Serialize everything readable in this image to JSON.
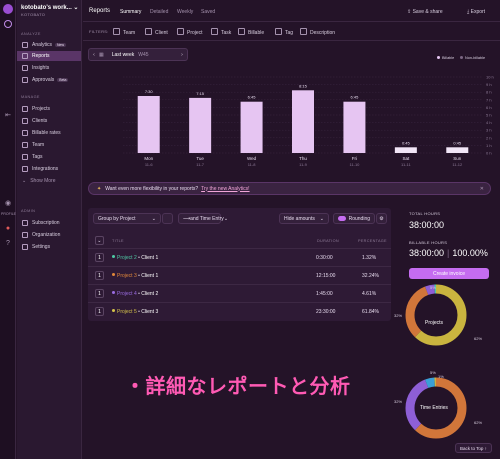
{
  "sidebar": {
    "workspace_name": "kotobato's work...",
    "workspace_sub": "KOTOBATO",
    "analyze_label": "ANALYZE",
    "manage_label": "MANAGE",
    "admin_label": "ADMIN",
    "analytics": {
      "label": "Analytics",
      "badge": "New"
    },
    "reports": {
      "label": "Reports"
    },
    "insights": {
      "label": "Insights"
    },
    "approvals": {
      "label": "Approvals",
      "badge": "Beta"
    },
    "projects": {
      "label": "Projects"
    },
    "clients": {
      "label": "Clients"
    },
    "billable_rates": {
      "label": "Billable rates"
    },
    "team": {
      "label": "Team"
    },
    "tags": {
      "label": "Tags"
    },
    "integrations": {
      "label": "Integrations"
    },
    "show_more": {
      "label": "Show More"
    },
    "subscription": {
      "label": "Subscription"
    },
    "organization": {
      "label": "Organization"
    },
    "settings": {
      "label": "Settings"
    }
  },
  "rail": {
    "profile_label": "PROFILE"
  },
  "header": {
    "title": "Reports",
    "tabs": [
      "Summary",
      "Detailed",
      "Weekly",
      "Saved"
    ],
    "save_share": "Save & share",
    "export": "Export"
  },
  "filters": {
    "label": "FILTERS:",
    "items": [
      "Team",
      "Client",
      "Project",
      "Task",
      "Billable",
      "Tag",
      "Description"
    ]
  },
  "date": {
    "label": "Last week",
    "week": "W45"
  },
  "legend": {
    "billable": "Billable",
    "non_billable": "Non-billable"
  },
  "colors": {
    "accent": "#c56cf0",
    "bar": "#e6c5f2",
    "bar_small": "#f2e6f7",
    "headline": "#ff5ab4"
  },
  "chart_data": {
    "type": "bar",
    "categories": [
      "Mon",
      "Tue",
      "Wed",
      "Thu",
      "Fri",
      "Sat",
      "Sun"
    ],
    "dates": [
      "11-6",
      "11-7",
      "11-8",
      "11-9",
      "11-10",
      "11-11",
      "11-12"
    ],
    "value_labels": [
      "7:30",
      "7:15",
      "6:45",
      "8:15",
      "6:45",
      "0:45",
      "0:45"
    ],
    "values": [
      7.5,
      7.25,
      6.75,
      8.25,
      6.75,
      0.75,
      0.75
    ],
    "ylabel_ticks": [
      "10 h",
      "9 h",
      "8 h",
      "7 h",
      "6 h",
      "5 h",
      "4 h",
      "3 h",
      "2 h",
      "1 h",
      "0 h"
    ],
    "ylim": [
      0,
      10
    ],
    "grid": true
  },
  "promo": {
    "text": "Want even more flexibility in your reports?",
    "link": "Try the new Analytics!"
  },
  "table": {
    "group_by": "Group by Project",
    "and_by": "and Time Entry",
    "hide_amounts": "Hide amounts",
    "rounding": "Rounding",
    "col_title": "TITLE",
    "col_duration": "DURATION",
    "col_percentage": "PERCENTAGE",
    "rows": [
      {
        "num": "1",
        "project": "Project 2",
        "client": "Client 1",
        "duration": "0:30:00",
        "pct": "1.32%",
        "color": "#4ec9a4"
      },
      {
        "num": "1",
        "project": "Project 3",
        "client": "Client 1",
        "duration": "12:15:00",
        "pct": "32.24%",
        "color": "#e0873a"
      },
      {
        "num": "1",
        "project": "Project 4",
        "client": "Client 2",
        "duration": "1:45:00",
        "pct": "4.61%",
        "color": "#9a6ce0"
      },
      {
        "num": "1",
        "project": "Project 5",
        "client": "Client 3",
        "duration": "23:30:00",
        "pct": "61.84%",
        "color": "#d4c24a"
      }
    ]
  },
  "summary": {
    "total_label": "TOTAL HOURS",
    "total_value": "38:00:00",
    "billable_label": "BILLABLE HOURS",
    "billable_value": "38:00:00",
    "billable_pct": "100.00%",
    "create_invoice": "Create invoice"
  },
  "donuts": [
    {
      "label": "Projects",
      "slices": [
        {
          "pct": 62,
          "color": "#c9b43f"
        },
        {
          "pct": 32,
          "color": "#d1763a"
        },
        {
          "pct": 5,
          "color": "#8e5fd6"
        },
        {
          "pct": 1,
          "color": "#4ec9a4"
        }
      ],
      "labels": [
        "62%",
        "32%",
        "5%"
      ]
    },
    {
      "label": "Time Entries",
      "slices": [
        {
          "pct": 62,
          "color": "#d1763a"
        },
        {
          "pct": 32,
          "color": "#8e5fd6"
        },
        {
          "pct": 5,
          "color": "#3a9fd6"
        },
        {
          "pct": 1,
          "color": "#c9b43f"
        }
      ],
      "labels": [
        "62%",
        "32%",
        "5%",
        "1%"
      ]
    }
  ],
  "headline": "・詳細なレポートと分析",
  "back_to_top": "Back to Top ↑"
}
